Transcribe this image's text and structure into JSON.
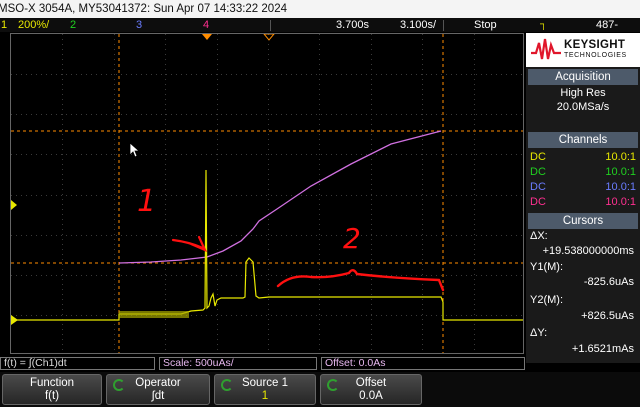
{
  "title_bar": {
    "text": "MSO-X 3054A, MY53041372: Sun Apr 07 14:33:22 2024"
  },
  "channel_strip": {
    "ch1": {
      "num": "1",
      "scale": "200%/"
    },
    "ch2": {
      "num": "2"
    },
    "ch3": {
      "num": "3"
    },
    "ch4": {
      "num": "4"
    },
    "horizontal": "3.700s",
    "time_per_div": "3.100s/",
    "run_state": "Stop",
    "trigger_level": "487‐"
  },
  "brand": {
    "name": "KEYSIGHT",
    "sub": "TECHNOLOGIES"
  },
  "acquisition": {
    "header": "Acquisition",
    "mode": "High Res",
    "rate": "20.0MSa/s"
  },
  "channels": {
    "header": "Channels",
    "rows": [
      {
        "coupling": "DC",
        "probe": "10.0:1",
        "color": "#e8e800"
      },
      {
        "coupling": "DC",
        "probe": "10.0:1",
        "color": "#20d020"
      },
      {
        "coupling": "DC",
        "probe": "10.0:1",
        "color": "#6a7cff"
      },
      {
        "coupling": "DC",
        "probe": "10.0:1",
        "color": "#ff3090"
      }
    ]
  },
  "cursors": {
    "header": "Cursors",
    "dx_label": "ΔX:",
    "dx_value": "+19.538000000ms",
    "y1_label": "Y1(M):",
    "y1_value": "-825.6uAs",
    "y2_label": "Y2(M):",
    "y2_value": "+826.5uAs",
    "dy_label": "ΔY:",
    "dy_value": "+1.6521mAs"
  },
  "status_line": {
    "math_expr": "f(t) = ∫(Ch1)dt",
    "scale": "Scale: 500uAs/",
    "offset": "Offset: 0.0As"
  },
  "softkeys": [
    {
      "top": "Function",
      "bottom": "f(t)"
    },
    {
      "top": "Operator",
      "bottom": "∫dt"
    },
    {
      "top": "Source 1",
      "bottom": "1"
    },
    {
      "top": "Offset",
      "bottom": "0.0A"
    }
  ],
  "annotations": {
    "label1": "1",
    "label2": "2"
  },
  "colors": {
    "ch1": "#e8e800",
    "ch2": "#20d020",
    "ch3": "#6a7cff",
    "ch4": "#ff3090",
    "math": "#d070e0",
    "cursor": "#ff8c00",
    "annotation": "#ff1010",
    "header": "#4d5a6a"
  }
}
